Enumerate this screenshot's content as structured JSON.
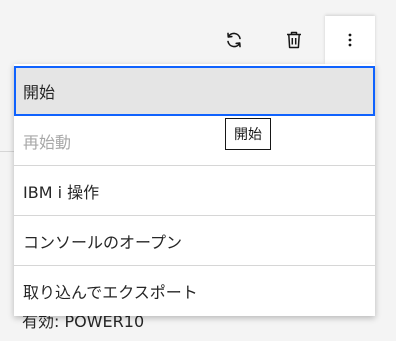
{
  "toolbar": {
    "icons": [
      "refresh-icon",
      "trash-icon",
      "overflow-menu-vertical-icon"
    ]
  },
  "menu": {
    "items": [
      {
        "label": "開始",
        "state": "selected"
      },
      {
        "label": "再始動",
        "state": "disabled"
      },
      {
        "label": "IBM i 操作",
        "state": "enabled"
      },
      {
        "label": "コンソールのオープン",
        "state": "enabled"
      },
      {
        "label": "取り込んでエクスポート",
        "state": "enabled"
      }
    ]
  },
  "tooltip": {
    "text": "開始"
  },
  "background": {
    "status_text": "有効: POWER10"
  },
  "colors": {
    "focus_border": "#0f62fe",
    "selected_bg": "#e5e5e5",
    "disabled_text": "#a8a8a8",
    "page_bg": "#f4f4f4"
  }
}
